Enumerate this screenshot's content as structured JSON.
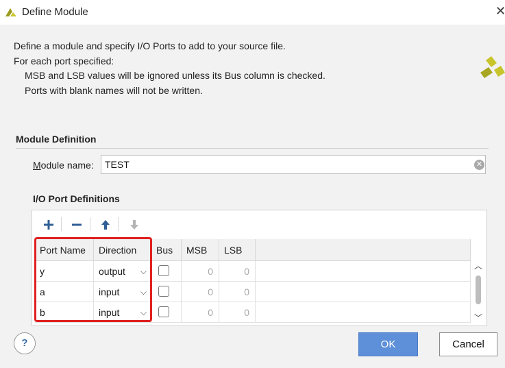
{
  "window": {
    "title": "Define Module",
    "close_icon": "close-icon"
  },
  "description": {
    "line1": "Define a module and specify I/O Ports to add to your source file.",
    "line2": "For each port specified:",
    "line3": "MSB and LSB values will be ignored unless its Bus column is checked.",
    "line4": "Ports with blank names will not be written."
  },
  "module_definition": {
    "section_title": "Module Definition",
    "name_label_prefix": "M",
    "name_label_rest": "odule name:",
    "name_value": "TEST"
  },
  "io_ports": {
    "section_title": "I/O Port Definitions",
    "toolbar_icons": [
      "plus-icon",
      "minus-icon",
      "arrow-up-icon",
      "arrow-down-icon"
    ],
    "columns": [
      "Port Name",
      "Direction",
      "Bus",
      "MSB",
      "LSB"
    ],
    "rows": [
      {
        "name": "y",
        "direction": "output",
        "bus": false,
        "msb": "0",
        "lsb": "0"
      },
      {
        "name": "a",
        "direction": "input",
        "bus": false,
        "msb": "0",
        "lsb": "0"
      },
      {
        "name": "b",
        "direction": "input",
        "bus": false,
        "msb": "0",
        "lsb": "0"
      }
    ]
  },
  "buttons": {
    "help": "?",
    "ok": "OK",
    "cancel": "Cancel"
  },
  "colors": {
    "ok_button": "#5e8fd9",
    "highlight": "#e02020",
    "logo": "#c8c42c"
  }
}
